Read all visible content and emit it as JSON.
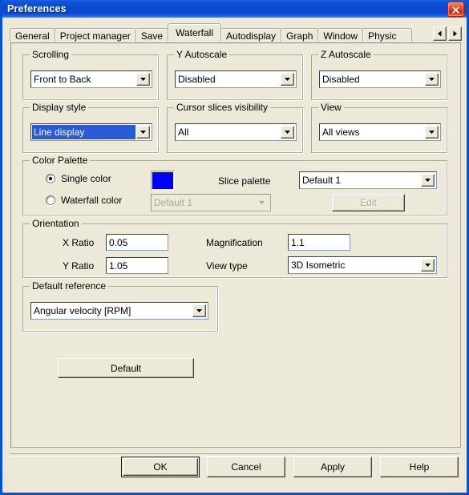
{
  "window": {
    "title": "Preferences",
    "close_icon": "close-icon"
  },
  "tabs": {
    "items": [
      {
        "label": "General",
        "active": false
      },
      {
        "label": "Project manager",
        "active": false
      },
      {
        "label": "Save",
        "active": false
      },
      {
        "label": "Waterfall",
        "active": true
      },
      {
        "label": "Autodisplay",
        "active": false
      },
      {
        "label": "Graph",
        "active": false
      },
      {
        "label": "Window",
        "active": false
      },
      {
        "label": "Physic",
        "active": false
      }
    ],
    "scroll_left_icon": "triangle-left-icon",
    "scroll_right_icon": "triangle-right-icon"
  },
  "groups": {
    "scrolling": {
      "label": "Scrolling",
      "value": "Front to Back"
    },
    "y_autoscale": {
      "label": "Y Autoscale",
      "value": "Disabled"
    },
    "z_autoscale": {
      "label": "Z Autoscale",
      "value": "Disabled"
    },
    "display_style": {
      "label": "Display style",
      "value": "Line display"
    },
    "cursor_slices": {
      "label": "Cursor slices visibility",
      "value": "All"
    },
    "view": {
      "label": "View",
      "value": "All views"
    },
    "color_palette": {
      "label": "Color Palette",
      "single_color_label": "Single color",
      "waterfall_color_label": "Waterfall color",
      "single_color_selected": true,
      "swatch_color": "#0000ff",
      "waterfall_palette_value": "Default 1",
      "slice_palette_label": "Slice palette",
      "slice_palette_value": "Default 1",
      "edit_label": "Edit"
    },
    "orientation": {
      "label": "Orientation",
      "x_ratio_label": "X Ratio",
      "x_ratio_value": "0.05",
      "y_ratio_label": "Y Ratio",
      "y_ratio_value": "1.05",
      "magnification_label": "Magnification",
      "magnification_value": "1.1",
      "view_type_label": "View type",
      "view_type_value": "3D Isometric"
    },
    "default_reference": {
      "label": "Default reference",
      "value": "Angular velocity [RPM]"
    }
  },
  "buttons": {
    "default": "Default",
    "ok": "OK",
    "cancel": "Cancel",
    "apply": "Apply",
    "help": "Help"
  }
}
